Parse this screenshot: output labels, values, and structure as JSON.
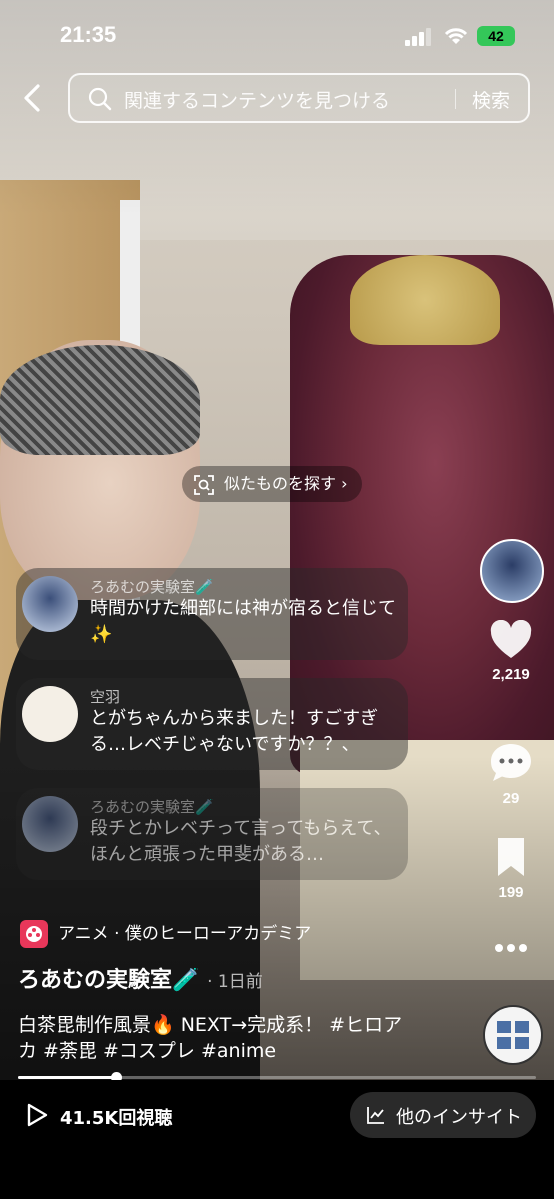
{
  "status_bar": {
    "time": "21:35",
    "battery": "42"
  },
  "search": {
    "placeholder": "関連するコンテンツを見つける",
    "button": "検索"
  },
  "find_similar": "似たものを探す",
  "comments": [
    {
      "user": "ろあむの実験室🧪",
      "text": "時間かけた細部には神が宿ると信じて✨"
    },
    {
      "user": "空羽",
      "text": "とがちゃんから来ました！すごすぎる…レベチじゃないですか？？、"
    },
    {
      "user": "ろあむの実験室🧪",
      "text": "段チとかレベチって言ってもらえて、ほんと頑張った甲斐がある…"
    }
  ],
  "actions": {
    "likes": "2,219",
    "comments": "29",
    "saves": "199"
  },
  "category": "アニメ · 僕のヒーローアカデミア",
  "author": {
    "name": "ろあむの実験室🧪",
    "when": "· 1日前"
  },
  "description": "白茶毘制作風景🔥 NEXT→完成系！ #ヒロアカ #荼毘 #コスプレ #anime",
  "progress": 0.19,
  "bottom_bar": {
    "views": "41.5K回視聴",
    "insight": "他のインサイト"
  },
  "colors": {
    "battery": "#34c759",
    "category_icon": "#e8375a"
  }
}
